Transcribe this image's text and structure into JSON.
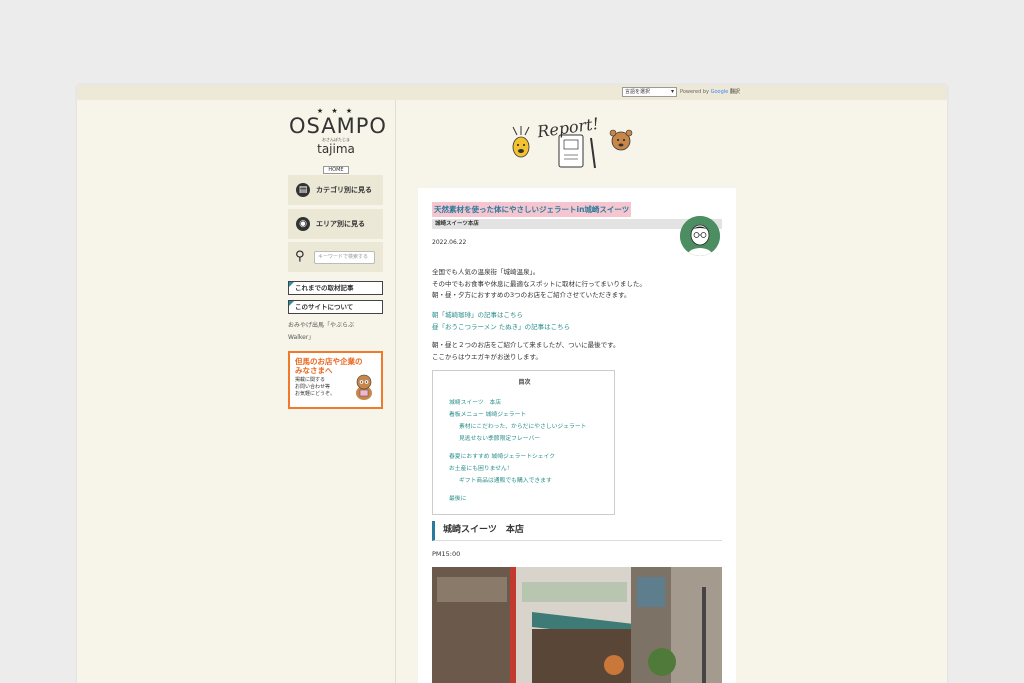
{
  "topbar": {
    "language_select": "言語を選択",
    "powered_prefix": "Powered by",
    "powered_google": "Google",
    "powered_translate": "翻訳"
  },
  "sidebar": {
    "logo": {
      "stars": "★ ★ ★",
      "title": "OSAMPO",
      "subtitle": "おさんぽたじま",
      "tajima": "tajima"
    },
    "home": "HOME",
    "category_button": "カテゴリ別に見る",
    "area_button": "エリア別に見る",
    "search_placeholder": "キーワードで検索する",
    "past_articles": "これまでの取材記事",
    "about_site": "このサイトについて",
    "note_line1": "おみやげ出馬「やぶらぶ",
    "note_line2": "Walker」",
    "banner": {
      "title_line1": "但馬のお店や企業の",
      "title_line2": "みなさまへ",
      "text_line1": "掲載に関する",
      "text_line2": "お問い合わせ等",
      "text_line3": "お気軽にどうぞ。"
    }
  },
  "header_art": {
    "label": "Report!"
  },
  "article": {
    "title": "天然素材を使った体にやさしいジェラートin城崎スイーツ",
    "store": "城崎スイーツ本店",
    "date": "2022.06.22",
    "p1": [
      "全国でも人気の温泉街「城崎温泉」。",
      "その中でもお食事や休息に最適なスポットに取材に行ってまいりました。",
      "朝・昼・夕方におすすめの3つのお店をご紹介させていただきます。"
    ],
    "p2": [
      "朝「城崎珈琲」の記事はこちら",
      "昼「おうこつラーメン たぬき」の記事はこちら"
    ],
    "p3": [
      "朝・昼と２つのお店をご紹介して来ましたが、ついに最後です。",
      "ここからはウエガキがお送りします。"
    ],
    "toc": {
      "title": "目次",
      "items": [
        "城崎スイーツ　本店",
        "看板メニュー 城崎ジェラート",
        "素材にこだわった、からだにやさしいジェラート",
        "見逃せない季節限定フレーバー",
        "春夏におすすめ 城崎ジェラートシェイク",
        "お土産にも困りません！",
        "ギフト商品は通販でも購入できます",
        "最後に"
      ]
    },
    "section_heading": "城崎スイーツ　本店",
    "time": "PM15:00"
  }
}
